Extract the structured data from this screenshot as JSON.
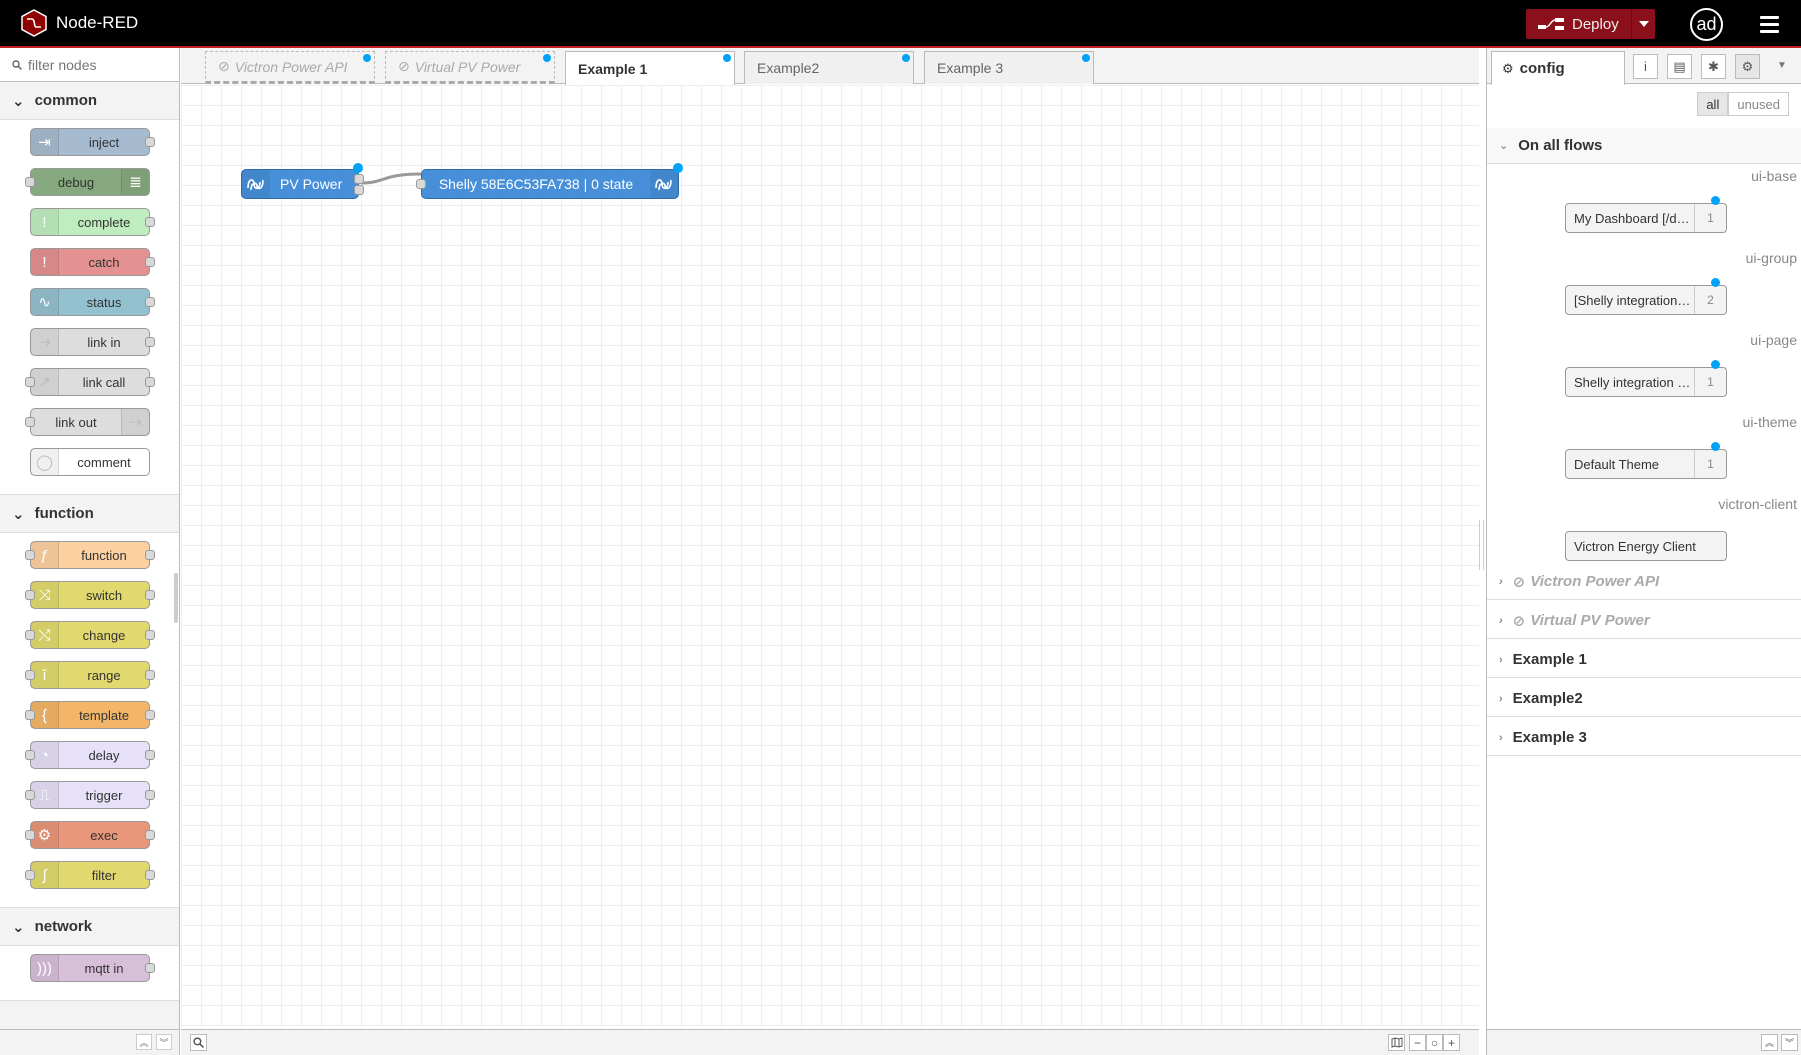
{
  "app": {
    "title": "Node-RED"
  },
  "header": {
    "deploy_label": "Deploy",
    "user_initials": "ad"
  },
  "palette": {
    "filter_placeholder": "filter nodes",
    "categories": [
      {
        "name": "common",
        "nodes": [
          {
            "label": "inject",
            "color": "#a6bbcf",
            "icon": "inject-icon",
            "input": false,
            "output": true,
            "icon_right": false
          },
          {
            "label": "debug",
            "color": "#87a980",
            "icon": "debug-icon",
            "input": true,
            "output": false,
            "icon_right": true
          },
          {
            "label": "complete",
            "color": "#c0edc0",
            "icon": "exclamation-icon",
            "input": false,
            "output": true,
            "icon_right": false
          },
          {
            "label": "catch",
            "color": "#e49191",
            "icon": "exclamation-icon",
            "input": false,
            "output": true,
            "icon_right": false
          },
          {
            "label": "status",
            "color": "#94c1d0",
            "icon": "status-icon",
            "input": false,
            "output": true,
            "icon_right": false
          },
          {
            "label": "link in",
            "color": "#dddddd",
            "icon": "link-in-icon",
            "input": false,
            "output": true,
            "icon_right": false
          },
          {
            "label": "link call",
            "color": "#dddddd",
            "icon": "link-call-icon",
            "input": true,
            "output": true,
            "icon_right": false
          },
          {
            "label": "link out",
            "color": "#dddddd",
            "icon": "link-out-icon",
            "input": true,
            "output": false,
            "icon_right": true
          },
          {
            "label": "comment",
            "color": "#ffffff",
            "icon": "comment-icon",
            "input": false,
            "output": false,
            "icon_right": false
          }
        ]
      },
      {
        "name": "function",
        "nodes": [
          {
            "label": "function",
            "color": "#fdd0a2",
            "icon": "function-icon",
            "input": true,
            "output": true,
            "icon_right": false
          },
          {
            "label": "switch",
            "color": "#e2d96e",
            "icon": "switch-icon",
            "input": true,
            "output": true,
            "icon_right": false
          },
          {
            "label": "change",
            "color": "#e2d96e",
            "icon": "change-icon",
            "input": true,
            "output": true,
            "icon_right": false
          },
          {
            "label": "range",
            "color": "#e2d96e",
            "icon": "range-icon",
            "input": true,
            "output": true,
            "icon_right": false
          },
          {
            "label": "template",
            "color": "#f3b567",
            "icon": "template-icon",
            "input": true,
            "output": true,
            "icon_right": false
          },
          {
            "label": "delay",
            "color": "#e6e0f8",
            "icon": "delay-icon",
            "input": true,
            "output": true,
            "icon_right": false
          },
          {
            "label": "trigger",
            "color": "#e6e0f8",
            "icon": "trigger-icon",
            "input": true,
            "output": true,
            "icon_right": false
          },
          {
            "label": "exec",
            "color": "#e9967a",
            "icon": "cog-icon",
            "input": true,
            "output": true,
            "icon_right": false
          },
          {
            "label": "filter",
            "color": "#e2d96e",
            "icon": "filter-icon",
            "input": true,
            "output": true,
            "icon_right": false
          }
        ]
      },
      {
        "name": "network",
        "nodes": [
          {
            "label": "mqtt in",
            "color": "#d8bfd8",
            "icon": "mqtt-icon",
            "input": false,
            "output": true,
            "icon_right": false
          }
        ]
      }
    ]
  },
  "workspace": {
    "tabs": [
      {
        "label": "Victron Power API",
        "disabled": true,
        "active": false
      },
      {
        "label": "Virtual PV Power",
        "disabled": true,
        "active": false
      },
      {
        "label": "Example 1",
        "disabled": false,
        "active": true
      },
      {
        "label": "Example2",
        "disabled": false,
        "active": false
      },
      {
        "label": "Example 3",
        "disabled": false,
        "active": false
      }
    ],
    "flow_nodes": [
      {
        "label": "PV Power",
        "color": "#4790d9",
        "icon": "victron-icon"
      },
      {
        "label": "Shelly 58E6C53FA738 | 0 state",
        "color": "#4790d9",
        "icon": "victron-icon"
      }
    ]
  },
  "sidebar": {
    "active_tab": "config",
    "filter": {
      "all": "all",
      "unused": "unused"
    },
    "sections": [
      {
        "label": "On all flows",
        "expanded": true,
        "disabled": false
      },
      {
        "label": "Victron Power API",
        "expanded": false,
        "disabled": true
      },
      {
        "label": "Virtual PV Power",
        "expanded": false,
        "disabled": true
      },
      {
        "label": "Example 1",
        "expanded": false,
        "disabled": false
      },
      {
        "label": "Example2",
        "expanded": false,
        "disabled": false
      },
      {
        "label": "Example 3",
        "expanded": false,
        "disabled": false
      }
    ],
    "config_nodes": [
      {
        "type": "ui-base",
        "name": "My Dashboard [/dashboard]",
        "count": "1"
      },
      {
        "type": "ui-group",
        "name": "[Shelly integration example] Group",
        "count": "2"
      },
      {
        "type": "ui-page",
        "name": "Shelly integration [/shelly]",
        "count": "1"
      },
      {
        "type": "ui-theme",
        "name": "Default Theme",
        "count": "1"
      },
      {
        "type": "victron-client",
        "name": "Victron Energy Client",
        "count": ""
      }
    ]
  }
}
